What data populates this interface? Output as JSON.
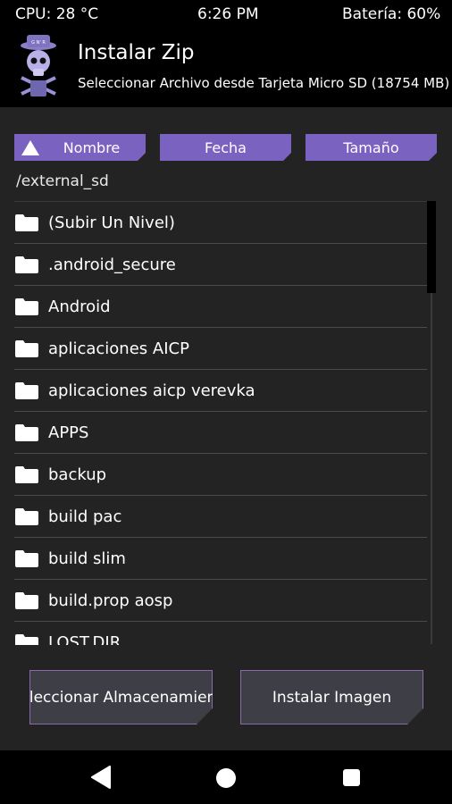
{
  "status_bar": {
    "cpu": "CPU: 28 °C",
    "time": "6:26 PM",
    "battery": "Batería: 60%"
  },
  "header": {
    "title": "Instalar Zip",
    "subtitle": "Seleccionar Archivo desde Tarjeta Micro SD (18754 MB)"
  },
  "sort": {
    "name": "Nombre",
    "date": "Fecha",
    "size": "Tamaño",
    "active": "name",
    "direction": "ascending"
  },
  "path": "/external_sd",
  "files": [
    "(Subir Un Nivel)",
    ".android_secure",
    "Android",
    "aplicaciones AICP",
    "aplicaciones aicp verevka",
    "APPS",
    "backup",
    "build pac",
    "build slim",
    "build.prop aosp",
    "LOST.DIR"
  ],
  "buttons": {
    "storage": "Seleccionar Almacenamiento",
    "install_image": "Instalar Imagen"
  },
  "colors": {
    "accent": "#7a62c0",
    "background": "#232323",
    "header": "#000000"
  }
}
